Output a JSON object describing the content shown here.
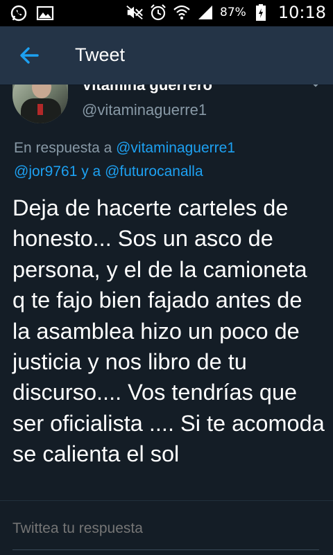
{
  "status_bar": {
    "icons_left": [
      "whatsapp-icon",
      "gallery-icon"
    ],
    "icons_right": [
      "mute-icon",
      "alarm-icon",
      "wifi-icon",
      "signal-icon"
    ],
    "battery_percent": "87%",
    "time": "10:18"
  },
  "app_bar": {
    "title": "Tweet"
  },
  "tweet": {
    "author_name": "Vitamina guerrero",
    "author_handle": "@vitaminaguerre1",
    "reply_prefix": "En respuesta a",
    "reply_to_1": "@vitaminaguerre1",
    "reply_to_2": "@jor9761",
    "reply_joiner": "y a",
    "reply_to_3": "@futurocanalla",
    "text": "Deja de hacerte carteles de honesto... Sos un asco de persona, y el de la camioneta q te fajo bien fajado antes de la asamblea hizo un poco de justicia y nos libro de tu discurso.... Vos tendrías que ser oficialista .... Si te acomoda se calienta el sol"
  },
  "reply_box": {
    "placeholder": "Twittea tu respuesta"
  },
  "colors": {
    "background": "#141d26",
    "app_bar": "#243447",
    "link": "#1da1f2",
    "muted": "#8899a6"
  }
}
